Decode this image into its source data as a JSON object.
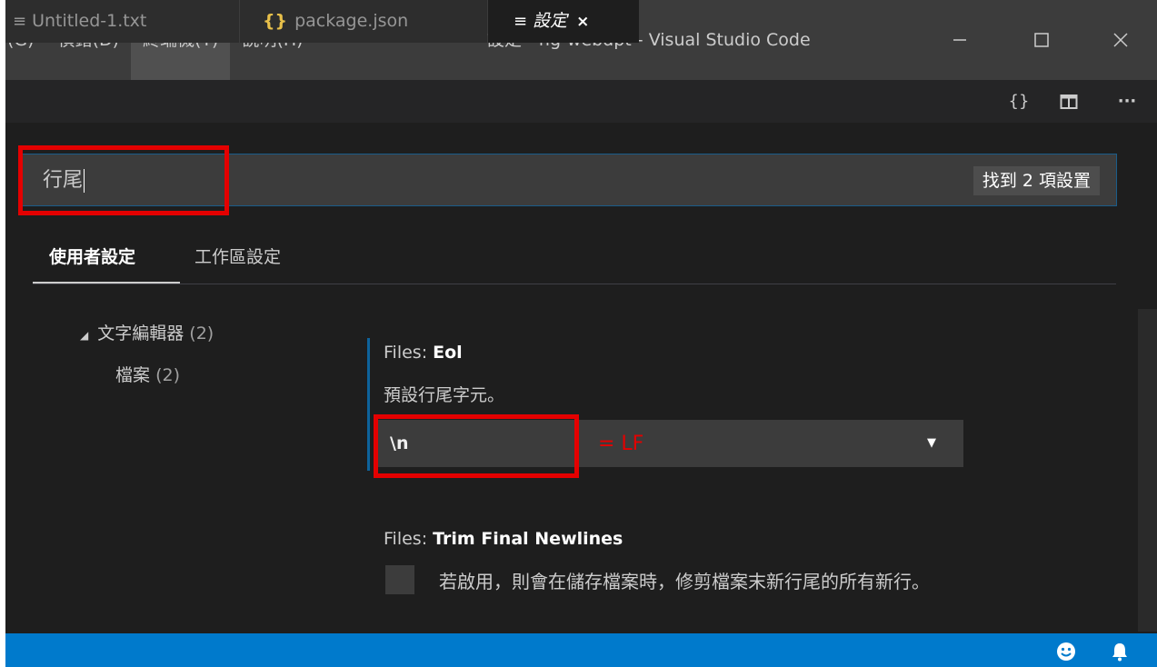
{
  "menu": {
    "items": [
      {
        "label": "(G)"
      },
      {
        "label": "偵錯(D)"
      },
      {
        "label": "終端機(T)"
      },
      {
        "label": "說明(H)"
      }
    ]
  },
  "window_title": "設定 - ng-webdpt - Visual Studio Code",
  "window_controls": {
    "minimize": "—",
    "maximize": "☐",
    "close": "✕"
  },
  "tabs": [
    {
      "label": "Untitled-1.txt",
      "icon": "≡"
    },
    {
      "label": "package.json",
      "icon": "{}"
    },
    {
      "label": "設定",
      "icon": "≡",
      "close": "×"
    }
  ],
  "tab_actions": {
    "open_json": "{}",
    "split": "◫",
    "more": "···"
  },
  "search": {
    "value": "行尾",
    "results": "找到 2 項設置"
  },
  "scopes": {
    "user": "使用者設定",
    "workspace": "工作區設定"
  },
  "tree": [
    {
      "label": "文字編輯器",
      "count": "(2)"
    },
    {
      "label": "檔案",
      "count": "(2)"
    }
  ],
  "settings": {
    "eol": {
      "category": "Files: ",
      "name": "Eol",
      "description": "預設行尾字元。",
      "value": "\\n",
      "annotation": "= LF",
      "arrow": "▼"
    },
    "trim": {
      "category": "Files: ",
      "name": "Trim Final Newlines",
      "description": "若啟用，則會在儲存檔案時，修剪檔案末新行尾的所有新行。",
      "checked": false
    }
  },
  "statusbar": {
    "feedback_icon": "☻",
    "bell_icon": "🔔"
  },
  "colors": {
    "accent": "#007acc",
    "highlight": "#e40000",
    "background": "#1e1e1e"
  }
}
